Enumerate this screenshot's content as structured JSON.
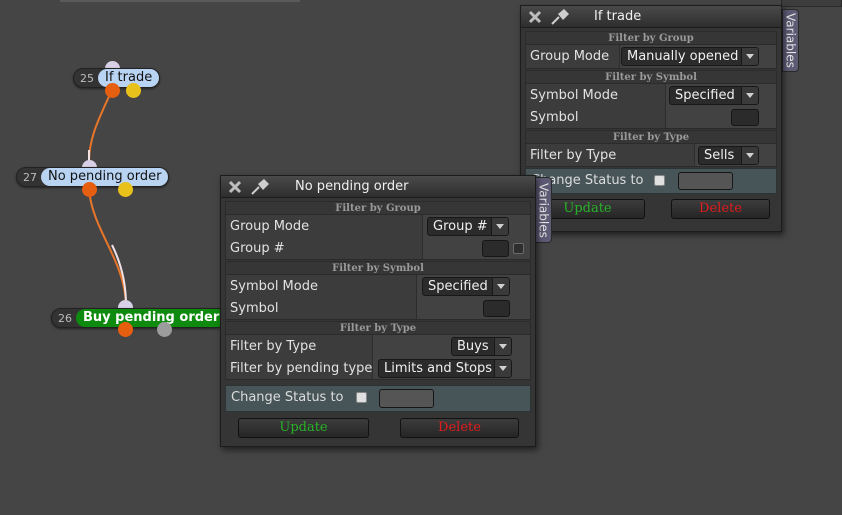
{
  "colors": {
    "canvas": "#454545",
    "node_label": "#b9d3f3",
    "node_label_action": "#0e8a0e",
    "edge_orange": "#e8762a",
    "edge_light": "#f2e2e6",
    "variables_tab": "#5d5a74",
    "update_text": "#28b328",
    "delete_text": "#e21c1c"
  },
  "nodes": [
    {
      "id": "25",
      "label": "If trade"
    },
    {
      "id": "27",
      "label": "No pending order"
    },
    {
      "id": "26",
      "label": "Buy pending order"
    }
  ],
  "panel_if_trade": {
    "title": "If trade",
    "variables_tab": "Variables",
    "close_icon": "close-x-icon",
    "pin_icon": "pin-icon",
    "sections": {
      "group": {
        "header": "Filter by Group",
        "mode_label": "Group Mode",
        "mode_value": "Manually opened"
      },
      "symbol": {
        "header": "Filter by Symbol",
        "mode_label": "Symbol Mode",
        "mode_value": "Specified",
        "symbol_label": "Symbol"
      },
      "type": {
        "header": "Filter by Type",
        "type_label": "Filter by Type",
        "type_value": "Sells"
      }
    },
    "status_label": "Change Status to",
    "update": "Update",
    "delete": "Delete"
  },
  "panel_no_pending": {
    "title": "No pending order",
    "variables_tab": "Variables",
    "sections": {
      "group": {
        "header": "Filter by Group",
        "mode_label": "Group Mode",
        "mode_value": "Group #",
        "group_label": "Group #"
      },
      "symbol": {
        "header": "Filter by Symbol",
        "mode_label": "Symbol Mode",
        "mode_value": "Specified",
        "symbol_label": "Symbol"
      },
      "type": {
        "header": "Filter by Type",
        "type_label": "Filter by Type",
        "type_value": "Buys",
        "pending_label": "Filter by pending type",
        "pending_value": "Limits and Stops"
      }
    },
    "status_label": "Change Status to",
    "update": "Update",
    "delete": "Delete"
  }
}
